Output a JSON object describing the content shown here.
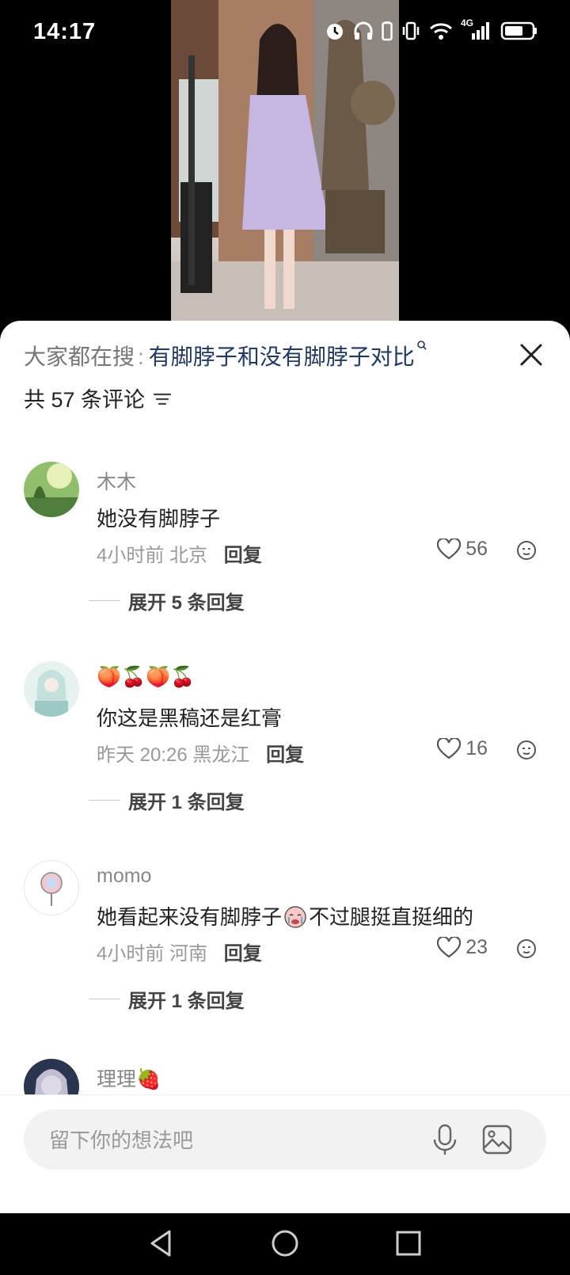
{
  "status_bar": {
    "time": "14:17",
    "network": "4G",
    "icons": [
      "alarm-icon",
      "headphones-icon",
      "battery-saver-icon",
      "vibrate-icon",
      "wifi-icon",
      "signal-icon",
      "battery-icon"
    ]
  },
  "comments_panel": {
    "search_label": "大家都在搜",
    "search_separator": ":",
    "search_query": "有脚脖子和没有脚脖子对比",
    "count_text": "共 57 条评论",
    "comments": [
      {
        "username": "木木",
        "text": "她没有脚脖子",
        "time": "4小时前",
        "location": "北京",
        "reply": "回复",
        "likes": "56",
        "expand": "展开 5 条回复"
      },
      {
        "username": "🍑🍒🍑🍒",
        "text": "你这是黑稿还是红膏",
        "time": "昨天 20:26",
        "location": "黑龙江",
        "reply": "回复",
        "likes": "16",
        "expand": "展开 1 条回复"
      },
      {
        "username": "momo",
        "text": "她看起来没有脚脖子",
        "text_tail": "不过腿挺直挺细的",
        "time": "4小时前",
        "location": "河南",
        "reply": "回复",
        "likes": "23",
        "expand": "展开 1 条回复"
      },
      {
        "username": "理理🍓"
      }
    ]
  },
  "input_bar": {
    "placeholder": "留下你的想法吧"
  },
  "colors": {
    "accent_query": "#1f3a68",
    "muted": "#999999",
    "text": "#222222"
  }
}
